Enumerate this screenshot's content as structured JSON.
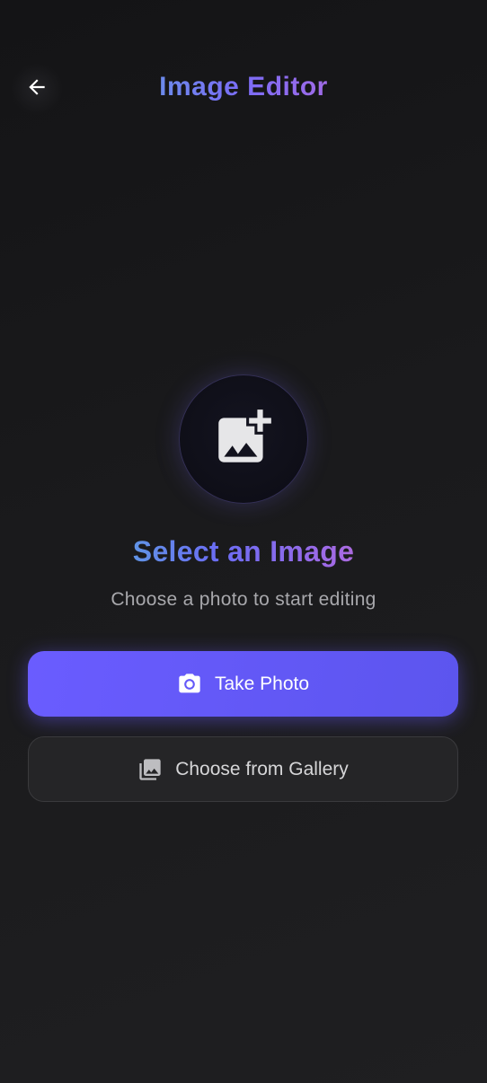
{
  "header": {
    "title": "Image Editor",
    "back_icon": "arrow-left-icon"
  },
  "empty_state": {
    "icon": "add-photo-icon",
    "headline": "Select an Image",
    "subtitle": "Choose a photo to start editing"
  },
  "actions": {
    "take_photo": {
      "label": "Take Photo",
      "icon": "camera-icon"
    },
    "gallery": {
      "label": "Choose from Gallery",
      "icon": "photo-library-icon"
    }
  },
  "colors": {
    "background": "#1a1a1c",
    "primary": "#6a5cff",
    "secondary_button": "#252527",
    "title_gradient": [
      "#4fc3d7",
      "#7b6cf6",
      "#ef6b82"
    ]
  }
}
